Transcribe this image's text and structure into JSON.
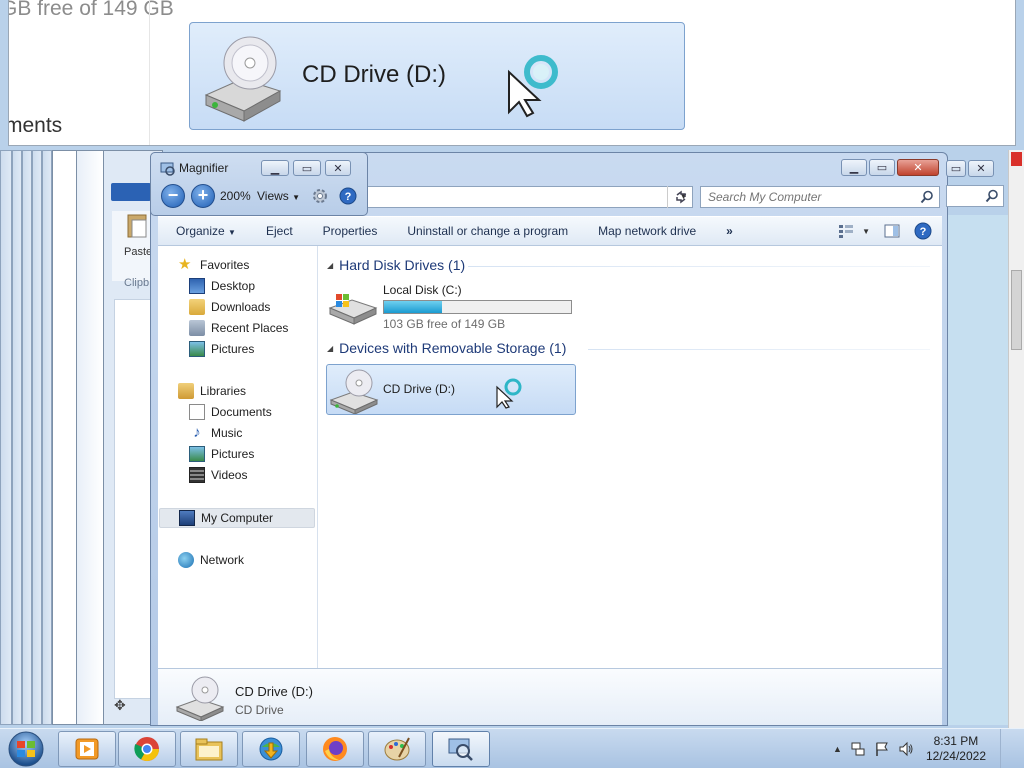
{
  "lens": {
    "partial_text_top": "GB free of 149 GB",
    "partial_text_left": "ments",
    "tile_label": "CD Drive (D:)"
  },
  "background_window": {
    "paste_label": "Paste",
    "clipboard_label": "Clipb"
  },
  "explorer": {
    "search_placeholder": "Search My Computer",
    "toolbar": {
      "organize": "Organize",
      "eject": "Eject",
      "properties": "Properties",
      "uninstall": "Uninstall or change a program",
      "map_network": "Map network drive",
      "more": "»"
    },
    "nav": {
      "favorites": "Favorites",
      "desktop": "Desktop",
      "downloads": "Downloads",
      "recent_places": "Recent Places",
      "pictures": "Pictures",
      "libraries": "Libraries",
      "documents": "Documents",
      "music": "Music",
      "lib_pictures": "Pictures",
      "videos": "Videos",
      "my_computer": "My Computer",
      "network": "Network"
    },
    "groups": {
      "hard_disk": "Hard Disk Drives (1)",
      "removable": "Devices with Removable Storage (1)"
    },
    "local_disk": {
      "name": "Local Disk (C:)",
      "free_text": "103 GB free of 149 GB",
      "used_fraction": 0.31
    },
    "cd_drive": {
      "name": "CD Drive (D:)"
    },
    "details": {
      "name": "CD Drive (D:)",
      "type": "CD Drive"
    }
  },
  "magnifier": {
    "title": "Magnifier",
    "zoom": "200%",
    "views": "Views"
  },
  "taskbar": {
    "time": "8:31 PM",
    "date": "12/24/2022",
    "apps": [
      "media-player",
      "chrome",
      "file-explorer",
      "idm",
      "firefox",
      "paint",
      "magnifier"
    ]
  },
  "colors": {
    "accent": "#1a9bd1",
    "group_header": "#1e3a78",
    "selection": "#c6dbf5"
  }
}
